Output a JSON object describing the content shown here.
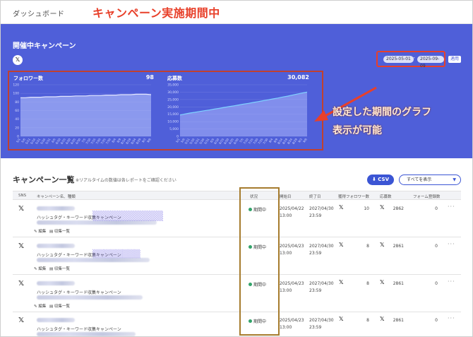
{
  "header": {
    "title": "ダッシュボード",
    "annotation": "キャンペーン実施期間中"
  },
  "panel": {
    "title": "開催中キャンペーン",
    "platform_icon": "x-logo-icon",
    "date_start": "2025-05-01",
    "date_separator": "-",
    "date_end": "2025-09-09",
    "apply_label": "適用",
    "annotation_line1": "設定した期間のグラフ",
    "annotation_line2": "表示が可能",
    "colors": {
      "panel": "#4f5fd9",
      "annotation": "#e8402a",
      "highlight_box": "#c04030"
    }
  },
  "chart_data": [
    {
      "type": "area",
      "title": "フォロワー数",
      "total_label": "98",
      "ylim": [
        0,
        120
      ],
      "yticks": [
        "120",
        "100",
        "80",
        "60",
        "40",
        "20",
        "0"
      ],
      "x": [
        "5/1",
        "5/6",
        "5/11",
        "5/16",
        "5/21",
        "5/26",
        "5/31",
        "6/5",
        "6/10",
        "6/15",
        "6/20",
        "6/25",
        "6/30",
        "7/5",
        "7/10",
        "7/15",
        "7/20",
        "7/25",
        "7/30",
        "8/4",
        "8/9",
        "8/14",
        "8/19",
        "8/24",
        "8/29",
        "9/3",
        "9/8"
      ],
      "values": [
        90,
        90,
        91,
        91,
        91,
        92,
        92,
        92,
        93,
        93,
        93,
        94,
        94,
        94,
        95,
        95,
        95,
        96,
        96,
        96,
        97,
        97,
        97,
        98,
        98,
        98,
        97
      ],
      "grid": true
    },
    {
      "type": "area",
      "title": "応募数",
      "total_label": "30,082",
      "ylim": [
        0,
        35000
      ],
      "yticks": [
        "35,000",
        "30,000",
        "25,000",
        "20,000",
        "15,000",
        "10,000",
        "5,000",
        "0"
      ],
      "x": [
        "5/1",
        "5/6",
        "5/11",
        "5/16",
        "5/21",
        "5/26",
        "5/31",
        "6/5",
        "6/10",
        "6/15",
        "6/20",
        "6/25",
        "6/30",
        "7/5",
        "7/10",
        "7/15",
        "7/20",
        "7/25",
        "7/30",
        "8/4",
        "8/9",
        "8/14",
        "8/19",
        "8/24",
        "8/29",
        "9/3",
        "9/8"
      ],
      "values": [
        14500,
        15200,
        15800,
        16300,
        16900,
        17400,
        17900,
        18500,
        19000,
        19600,
        20200,
        20700,
        21300,
        21900,
        22400,
        23000,
        23600,
        24200,
        24800,
        25400,
        26000,
        26700,
        27300,
        28000,
        28700,
        29400,
        30082
      ],
      "grid": true
    }
  ],
  "list": {
    "title": "キャンペーン一覧",
    "note": "※リアルタイムの数値は各レポートをご確認ください",
    "csv_label": "CSV",
    "filter_value": "すべてを表示",
    "columns": [
      "SNS",
      "キャンペーン名、種類",
      "状況",
      "開始日",
      "終了日",
      "獲得フォロワー数",
      "応募数",
      "フォーム登録数"
    ],
    "edit_label": "編集",
    "collect_label": "収集一覧",
    "rows": [
      {
        "type": "ハッシュタグ・キーワード収集キャンペーン",
        "status": "期間中",
        "start": "2025/04/22",
        "start_time": "13:00",
        "end": "2027/04/30",
        "end_time": "23:59",
        "followers": "10",
        "entries": "2862",
        "forms": "0"
      },
      {
        "type": "ハッシュタグ・キーワード収集キャンペーン",
        "status": "期間中",
        "start": "2025/04/23",
        "start_time": "13:00",
        "end": "2027/04/30",
        "end_time": "23:59",
        "followers": "8",
        "entries": "2861",
        "forms": "0"
      },
      {
        "type": "ハッシュタグ・キーワード収集キャンペーン",
        "status": "期間中",
        "start": "2025/04/23",
        "start_time": "13:00",
        "end": "2027/04/30",
        "end_time": "23:59",
        "followers": "8",
        "entries": "2861",
        "forms": "0"
      },
      {
        "type": "ハッシュタグ・キーワード収集キャンペーン",
        "status": "期間中",
        "start": "2025/04/23",
        "start_time": "13:00",
        "end": "2027/04/30",
        "end_time": "23:59",
        "followers": "8",
        "entries": "2861",
        "forms": "0"
      }
    ]
  }
}
